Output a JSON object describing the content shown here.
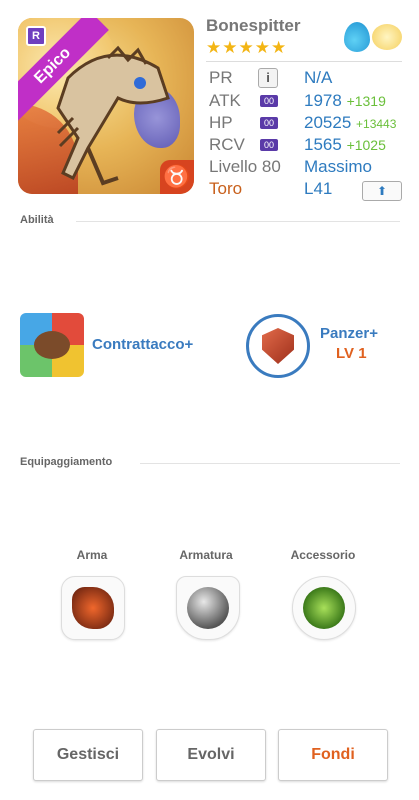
{
  "monster": {
    "name": "Bonespitter",
    "stars": "★★★★★",
    "rarity_badge": "R",
    "rarity": "Epico",
    "zodiac_symbol": "♉"
  },
  "stats": {
    "pr_label": "PR",
    "pr_value": "N/A",
    "atk_label": "ATK",
    "atk_value": "1978",
    "atk_plus": "+1319",
    "hp_label": "HP",
    "hp_value": "20525",
    "hp_plus": "+13443",
    "rcv_label": "RCV",
    "rcv_value": "1565",
    "rcv_plus": "+1025",
    "level_label": "Livello 80",
    "level_value": "Massimo",
    "zodiac_label": "Toro",
    "zodiac_value": "L41",
    "tag": "00",
    "info_symbol": "i",
    "up_symbol": "⬆"
  },
  "sections": {
    "abilities": "Abilità",
    "equipment": "Equipaggiamento"
  },
  "skills": {
    "active_name": "Contrattacco+",
    "leader_name": "Panzer+",
    "leader_level": "LV 1"
  },
  "equipment": {
    "weapon": "Arma",
    "armor": "Armatura",
    "accessory": "Accessorio"
  },
  "buttons": {
    "manage": "Gestisci",
    "evolve": "Evolvi",
    "fuse": "Fondi"
  },
  "colors": {
    "stat_blue": "#2e7bbf",
    "bonus_green": "#6abf3a",
    "accent_orange": "#e0611f",
    "rarity_purple": "#c02fc7"
  }
}
